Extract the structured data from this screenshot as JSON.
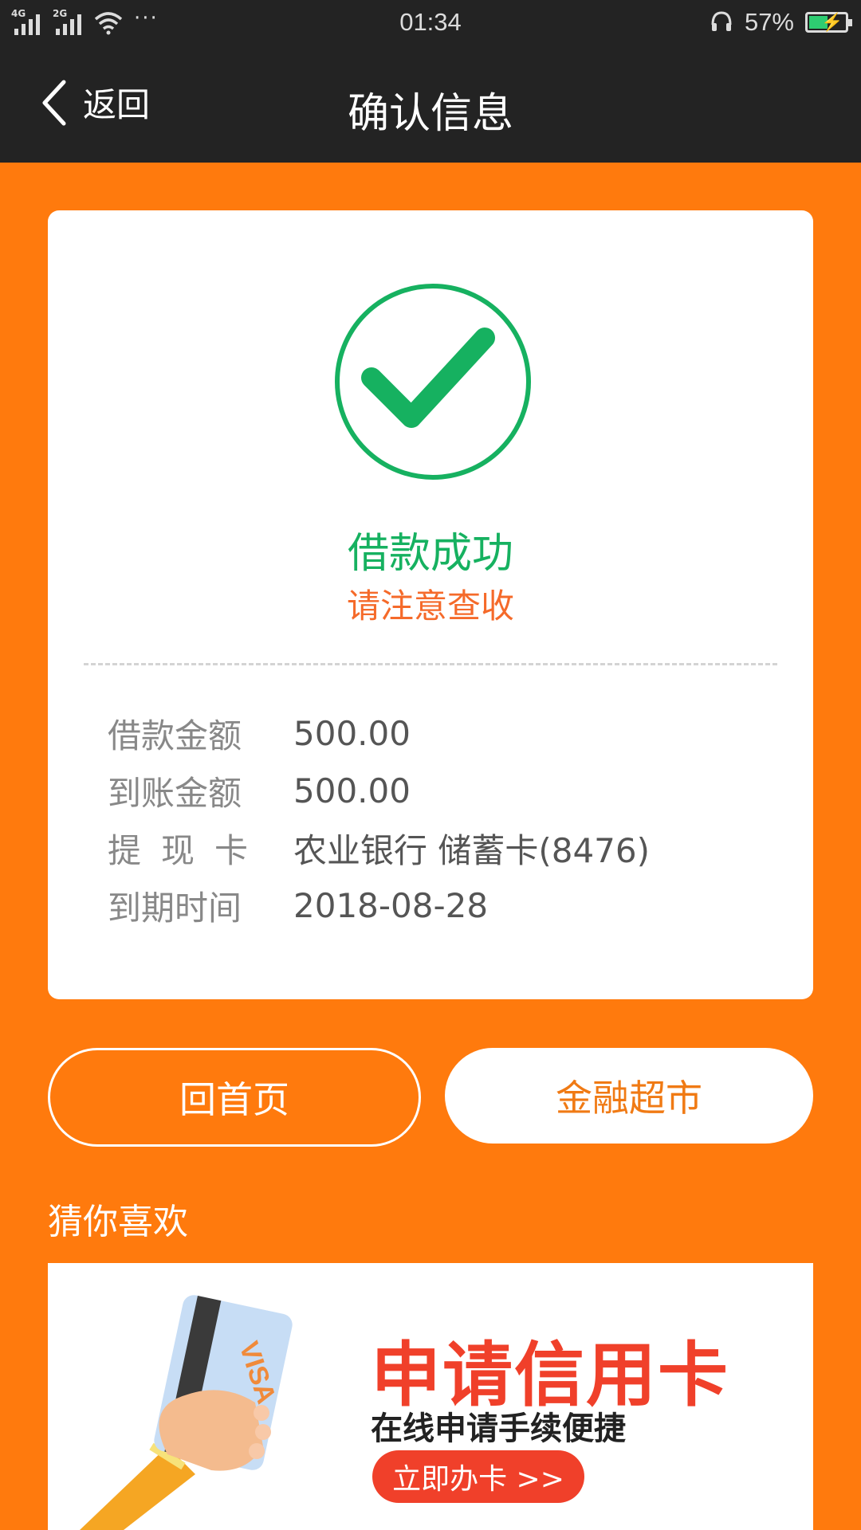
{
  "status_bar": {
    "network_1": "4G",
    "network_2": "2G",
    "more": "···",
    "time": "01:34",
    "battery_percent": "57%",
    "battery_level": 0.57
  },
  "nav": {
    "back_label": "返回",
    "title": "确认信息"
  },
  "result": {
    "title": "借款成功",
    "subtitle": "请注意查收",
    "success_color": "#16B160"
  },
  "details": [
    {
      "label": "借款金额",
      "value": "500.00"
    },
    {
      "label": "到账金额",
      "value": "500.00"
    },
    {
      "label": "提现卡",
      "value": "农业银行 储蓄卡(8476)"
    },
    {
      "label": "到期时间",
      "value": "2018-08-28"
    }
  ],
  "buttons": {
    "home": "回首页",
    "market": "金融超市"
  },
  "recommend": {
    "title": "猜你喜欢",
    "banner": {
      "title": "申请信用卡",
      "subtitle": "在线申请手续便捷",
      "cta": "立即办卡 >>",
      "card_text": "VISA"
    }
  },
  "colors": {
    "background": "#FF7A0D",
    "header": "#232323",
    "accent_red": "#F0402A"
  }
}
